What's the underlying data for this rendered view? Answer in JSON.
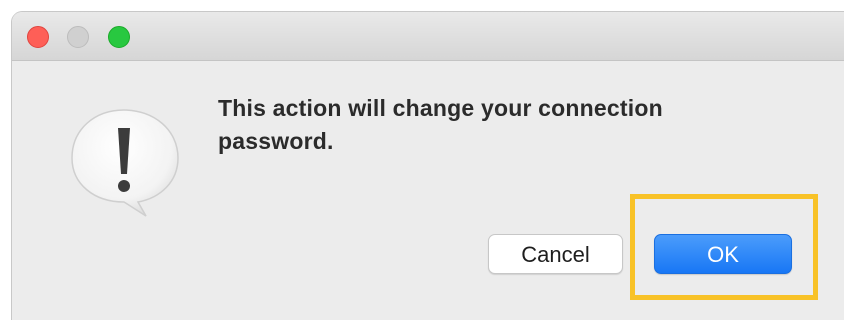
{
  "dialog": {
    "message": "This action will change your connection password.",
    "icon": "exclamation-speech-bubble-icon",
    "buttons": {
      "cancel_label": "Cancel",
      "ok_label": "OK"
    }
  },
  "window_controls": [
    "close",
    "minimize",
    "zoom"
  ],
  "colors": {
    "close": "#fe5f57",
    "minimize": "#d0d0d0",
    "zoom": "#28c840",
    "ok_button": "#1877f5",
    "highlight": "#f8c227",
    "background": "#ececec"
  }
}
